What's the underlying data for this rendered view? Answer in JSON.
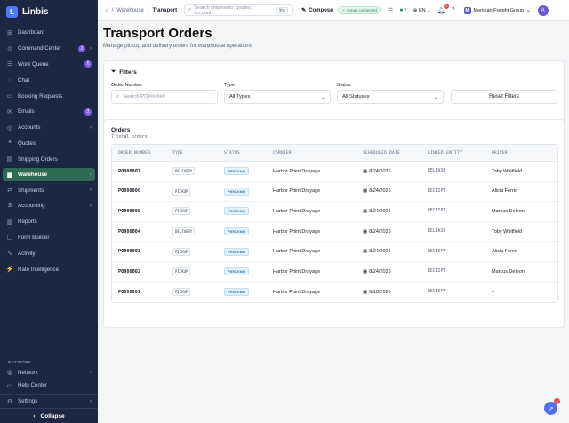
{
  "brand": {
    "logo": "L",
    "name": "Linbis"
  },
  "sidebar": {
    "items": [
      {
        "label": "Dashboard",
        "icon": "⊞"
      },
      {
        "label": "Command Center",
        "icon": "⊙",
        "badge": "2",
        "chevron": "›"
      },
      {
        "label": "Work Queue",
        "icon": "☰",
        "badge": "6"
      },
      {
        "label": "Chat",
        "icon": "◌"
      },
      {
        "label": "Booking Requests",
        "icon": "▭"
      },
      {
        "label": "Emails",
        "icon": "✉",
        "badge": "3"
      },
      {
        "label": "Accounts",
        "icon": "◎",
        "chevron": "›"
      },
      {
        "label": "Quotes",
        "icon": "❝"
      },
      {
        "label": "Shipping Orders",
        "icon": "▤"
      },
      {
        "label": "Warehouse",
        "icon": "▦",
        "chevron": "›",
        "active": true
      },
      {
        "label": "Shipments",
        "icon": "⇄",
        "chevron": "›"
      },
      {
        "label": "Accounting",
        "icon": "$",
        "chevron": "›"
      },
      {
        "label": "Reports",
        "icon": "▥"
      },
      {
        "label": "Form Builder",
        "icon": "▢"
      },
      {
        "label": "Activity",
        "icon": "∿"
      },
      {
        "label": "Rate Intelligence",
        "icon": "⚡"
      }
    ],
    "section_label": "NETWORK",
    "network_items": [
      {
        "label": "Network",
        "icon": "◍",
        "chevron": "›"
      },
      {
        "label": "Help Center",
        "icon": "▭"
      }
    ],
    "settings": {
      "label": "Settings",
      "icon": "⚙",
      "chevron": "›"
    },
    "collapse_label": "Collapse",
    "collapse_icon": "‹"
  },
  "topbar": {
    "breadcrumb": {
      "home_icon": "⌂",
      "parent": "Warehouse",
      "current": "Transport"
    },
    "search": {
      "placeholder": "Search shipments, quotes, account...",
      "shortcut": "⌘K"
    },
    "compose_label": "Compose",
    "connected_label": "Gmail connected",
    "lang": "EN",
    "notif_count": "3",
    "org": {
      "logo": "M",
      "name": "Meridian Freight Group"
    },
    "avatar": "A"
  },
  "page": {
    "title": "Transport Orders",
    "subtitle": "Manage pickup and delivery orders for warehouse operations"
  },
  "filters": {
    "title": "Filters",
    "order_number_label": "Order Number",
    "order_number_placeholder": "Search PO######",
    "type_label": "Type",
    "type_value": "All Types",
    "status_label": "Status",
    "status_value": "All Statuses",
    "reset_label": "Reset Filters"
  },
  "orders": {
    "title": "Orders",
    "count": "7 total orders",
    "columns": [
      "ORDER NUMBER",
      "TYPE",
      "STATUS",
      "CARRIER",
      "SCHEDULED DATE",
      "LINKED ENTITY",
      "DRIVER"
    ],
    "rows": [
      {
        "order": "PO000007",
        "type": "DELIVERY",
        "status": "PENDING",
        "carrier": "Harbor Point Drayage",
        "date": "8/24/2026",
        "entity": "RELEASE",
        "driver": "Toby Whitfield"
      },
      {
        "order": "PO000006",
        "type": "PICKUP",
        "status": "PENDING",
        "carrier": "Harbor Point Drayage",
        "date": "8/24/2026",
        "entity": "RECEIPT",
        "driver": "Alicia Ferrer"
      },
      {
        "order": "PO000005",
        "type": "PICKUP",
        "status": "PENDING",
        "carrier": "Harbor Point Drayage",
        "date": "8/24/2026",
        "entity": "RECEIPT",
        "driver": "Marcus Deleon"
      },
      {
        "order": "PO000004",
        "type": "DELIVERY",
        "status": "PENDING",
        "carrier": "Harbor Point Drayage",
        "date": "8/24/2026",
        "entity": "RELEASE",
        "driver": "Toby Whitfield"
      },
      {
        "order": "PO000003",
        "type": "PICKUP",
        "status": "PENDING",
        "carrier": "Harbor Point Drayage",
        "date": "8/24/2026",
        "entity": "RECEIPT",
        "driver": "Alicia Ferrer"
      },
      {
        "order": "PO000002",
        "type": "PICKUP",
        "status": "PENDING",
        "carrier": "Harbor Point Drayage",
        "date": "8/24/2026",
        "entity": "RECEIPT",
        "driver": "Marcus Deleon"
      },
      {
        "order": "PO000001",
        "type": "PICKUP",
        "status": "PENDING",
        "carrier": "Harbor Point Drayage",
        "date": "8/18/2026",
        "entity": "RECEIPT",
        "driver": "–"
      }
    ]
  },
  "fab": {
    "icon": "⇗",
    "badge": "3"
  },
  "colors": {
    "sidebar_bg": "#1c2842",
    "active_bg": "#2f6b52",
    "accent": "#4f7cff",
    "badge": "#7b5cf0"
  }
}
